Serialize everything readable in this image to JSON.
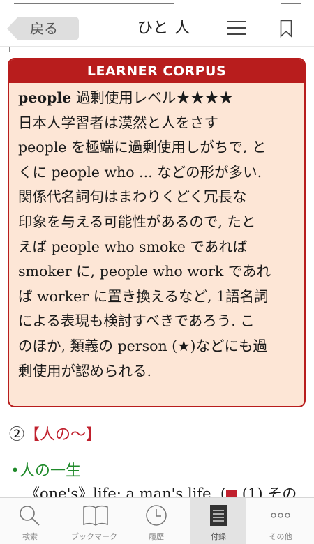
{
  "header": {
    "back_label": "戻る",
    "title": "ひと 人"
  },
  "corpus": {
    "heading": "LEARNER CORPUS",
    "headword": "people",
    "level_label": "過剰使用レベル★★★★",
    "lines": [
      "日本人学習者は漠然と人をさす",
      "people を極端に過剰使用しがちで, と",
      "くに people who ... などの形が多い.",
      "関係代名詞句はまわりくどく冗長な",
      "印象を与える可能性があるので, たと",
      "えば people who smoke であれば",
      "smoker に, people who work であれ",
      "ば worker に置き換えるなど, 1語名詞",
      "による表現も検討すべきであろう. こ",
      "のほか, 類義の person (★)などにも過",
      "剰使用が認められる."
    ]
  },
  "section": {
    "number": "②",
    "heading": "【人の〜】"
  },
  "bullet": "•人の一生",
  "partial_line": "《one's》life; a man's life. (",
  "partial_tail": " (1) その",
  "tabs": [
    {
      "label": "検索",
      "icon": "search-icon"
    },
    {
      "label": "ブックマーク",
      "icon": "book-icon"
    },
    {
      "label": "履歴",
      "icon": "clock-icon"
    },
    {
      "label": "付録",
      "icon": "list-icon"
    },
    {
      "label": "その他",
      "icon": "more-icon"
    }
  ],
  "colors": {
    "accent_red": "#b81d1d",
    "box_fill": "#fde6d6",
    "green": "#1f8a2a"
  }
}
